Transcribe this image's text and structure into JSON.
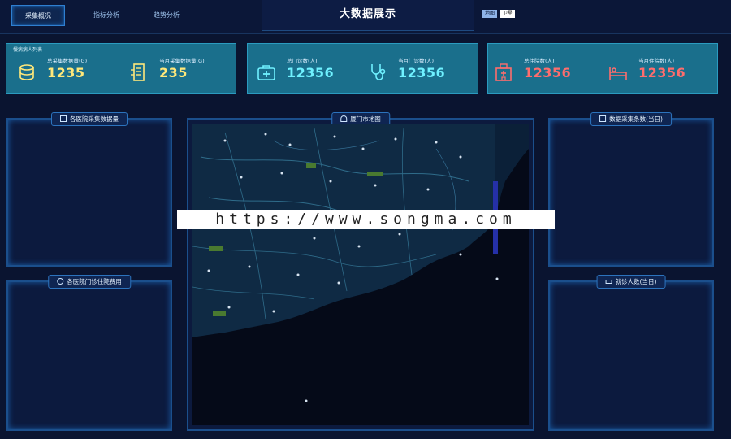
{
  "tabs": [
    {
      "label": "采集概况",
      "active": true
    },
    {
      "label": "指标分析",
      "active": false
    },
    {
      "label": "趋势分析",
      "active": false
    }
  ],
  "title": "大数据展示",
  "cards": [
    {
      "label": "慢病病人列表",
      "stats": [
        {
          "icon": "database-icon",
          "label": "总采集数据量(G)",
          "value": "1235",
          "color": "#ffe87a"
        },
        {
          "icon": "server-icon",
          "label": "当月采集数据量(G)",
          "value": "235",
          "color": "#ffe87a"
        }
      ]
    },
    {
      "label": "",
      "stats": [
        {
          "icon": "medical-kit-icon",
          "label": "总门诊数(人)",
          "value": "12356",
          "color": "#6ff1ff"
        },
        {
          "icon": "stethoscope-icon",
          "label": "当月门诊数(人)",
          "value": "12356",
          "color": "#6ff1ff"
        }
      ]
    },
    {
      "label": "",
      "stats": [
        {
          "icon": "hospital-icon",
          "label": "总住院数(人)",
          "value": "12356",
          "color": "#ff6d6d"
        },
        {
          "icon": "hospital-bed-icon",
          "label": "当月住院数(人)",
          "value": "12356",
          "color": "#ff6d6d"
        }
      ]
    }
  ],
  "panels": {
    "hospital_data": "各医院采集数据量",
    "hospital_cost": "各医院门诊住院费用",
    "map": "厦门市地图",
    "daily_records": "数据采集条数(当日)",
    "daily_visits": "就诊人数(当日)"
  },
  "map_toggle": {
    "map": "地图",
    "satellite": "卫星"
  },
  "watermark": "https://www.songma.com"
}
